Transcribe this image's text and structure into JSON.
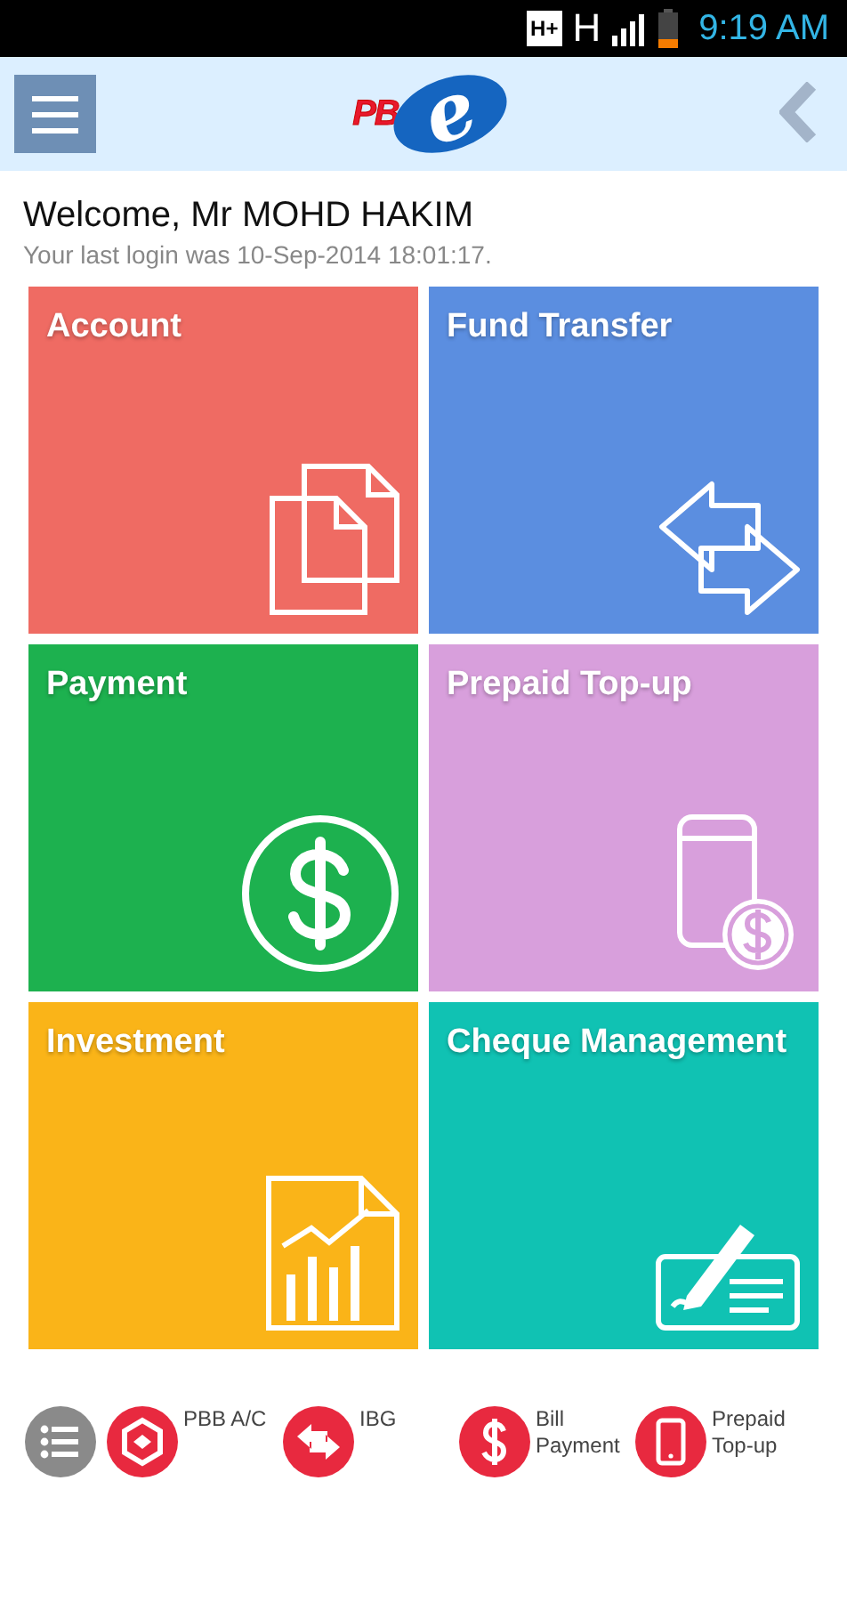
{
  "status_bar": {
    "data_badge": "H+",
    "network": "H",
    "time": "9:19 AM"
  },
  "header": {
    "logo_text": "PB",
    "logo_letter": "e"
  },
  "welcome": {
    "greeting": "Welcome, Mr MOHD HAKIM",
    "last_login": "Your last login was 10-Sep-2014 18:01:17."
  },
  "tiles": [
    {
      "label": "Account",
      "kind": "documents",
      "color": "#ef6b63"
    },
    {
      "label": "Fund Transfer",
      "kind": "transfer",
      "color": "#5b8ee0"
    },
    {
      "label": "Payment",
      "kind": "dollar",
      "color": "#1db14f"
    },
    {
      "label": "Prepaid Top-up",
      "kind": "phone",
      "color": "#d89fdc"
    },
    {
      "label": "Investment",
      "kind": "chart",
      "color": "#fab418"
    },
    {
      "label": "Cheque Management",
      "kind": "cheque",
      "color": "#10c2b3"
    }
  ],
  "shortcuts": [
    {
      "kind": "list"
    },
    {
      "kind": "account",
      "label": "PBB A/C"
    },
    {
      "kind": "transfer",
      "label": "IBG"
    },
    {
      "kind": "dollar",
      "label": "Bill Payment"
    },
    {
      "kind": "phone",
      "label": "Prepaid Top-up"
    }
  ]
}
